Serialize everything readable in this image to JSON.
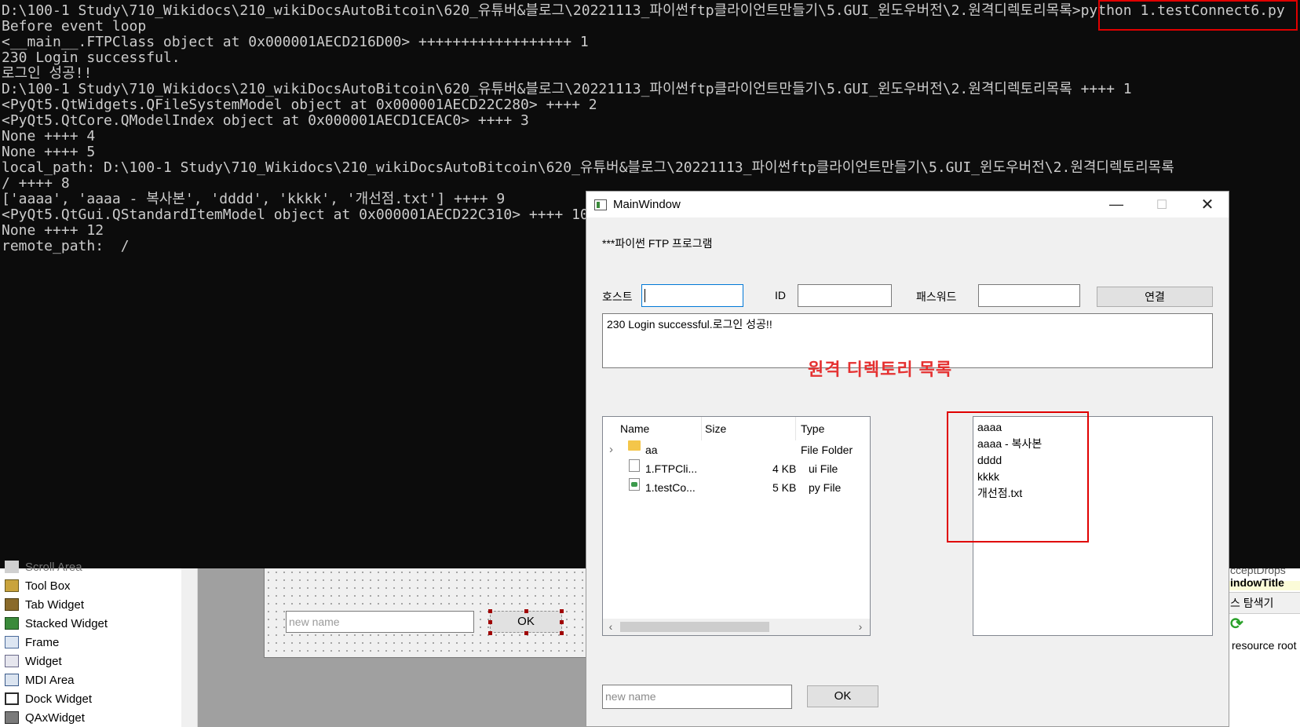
{
  "console": {
    "lines": [
      "D:\\100-1 Study\\710_Wikidocs\\210_wikiDocsAutoBitcoin\\620_유튜버&블로그\\20221113_파이썬ftp클라이언트만들기\\5.GUI_윈도우버전\\2.원격디렉토리목록>python 1.testConnect6.py",
      "Before event loop",
      "<__main__.FTPClass object at 0x000001AECD216D00> ++++++++++++++++++ 1",
      "230 Login successful.",
      "로그인 성공!!",
      "D:\\100-1 Study\\710_Wikidocs\\210_wikiDocsAutoBitcoin\\620_유튜버&블로그\\20221113_파이썬ftp클라이언트만들기\\5.GUI_윈도우버전\\2.원격디렉토리목록 ++++ 1",
      "<PyQt5.QtWidgets.QFileSystemModel object at 0x000001AECD22C280> ++++ 2",
      "<PyQt5.QtCore.QModelIndex object at 0x000001AECD1CEAC0> ++++ 3",
      "None ++++ 4",
      "None ++++ 5",
      "local_path: D:\\100-1 Study\\710_Wikidocs\\210_wikiDocsAutoBitcoin\\620_유튜버&블로그\\20221113_파이썬ftp클라이언트만들기\\5.GUI_윈도우버전\\2.원격디렉토리목록",
      "/ ++++ 8",
      "['aaaa', 'aaaa - 복사본', 'dddd', 'kkkk', '개선점.txt'] ++++ 9",
      "<PyQt5.QtGui.QStandardItemModel object at 0x000001AECD22C310> ++++ 10",
      "None ++++ 12",
      "remote_path:  /"
    ]
  },
  "designer": {
    "widget_box": {
      "partial_top": "Scroll Area",
      "items": [
        {
          "label": "Tool Box",
          "icon": "toolbox-icon"
        },
        {
          "label": "Tab Widget",
          "icon": "tab-widget-icon"
        },
        {
          "label": "Stacked Widget",
          "icon": "stacked-widget-icon"
        },
        {
          "label": "Frame",
          "icon": "frame-icon"
        },
        {
          "label": "Widget",
          "icon": "widget-icon"
        },
        {
          "label": "MDI Area",
          "icon": "mdi-area-icon"
        },
        {
          "label": "Dock Widget",
          "icon": "dock-widget-icon"
        },
        {
          "label": "QAxWidget",
          "icon": "qaxwidget-icon"
        }
      ]
    },
    "form": {
      "input_placeholder": "new name",
      "ok_label": "OK"
    },
    "right_panel": {
      "line1": "cceptDrops",
      "line2": "indowTitle",
      "line3": "스 탐색기",
      "line4": "resource root"
    }
  },
  "main_window": {
    "title": "MainWindow",
    "heading": "***파이썬 FTP 프로그램",
    "host_label": "호스트",
    "host_value": "",
    "id_label": "ID",
    "id_value": "",
    "password_label": "패스워드",
    "password_value": "",
    "connect_label": "연결",
    "log_text": "230 Login successful.로그인 성공!!",
    "annotation": "원격 디렉토리 목록",
    "tree": {
      "headers": {
        "name": "Name",
        "size": "Size",
        "type": "Type"
      },
      "rows": [
        {
          "name": "aa",
          "size": "",
          "type": "File Folder",
          "icon": "folder-icon",
          "expandable": true
        },
        {
          "name": "1.FTPCli...",
          "size": "4 KB",
          "type": "ui File",
          "icon": "ui-file-icon",
          "expandable": false
        },
        {
          "name": "1.testCo...",
          "size": "5 KB",
          "type": "py File",
          "icon": "py-file-icon",
          "expandable": false
        }
      ]
    },
    "remote_files": [
      "aaaa",
      "aaaa - 복사본",
      "dddd",
      "kkkk",
      "개선점.txt"
    ],
    "new_name_placeholder": "new name",
    "ok_label": "OK"
  },
  "colors": {
    "console_bg": "#0c0c0c",
    "console_text": "#cccccc",
    "highlight": "#e00000",
    "annotation": "#e53030",
    "focus_border": "#0078d7"
  }
}
